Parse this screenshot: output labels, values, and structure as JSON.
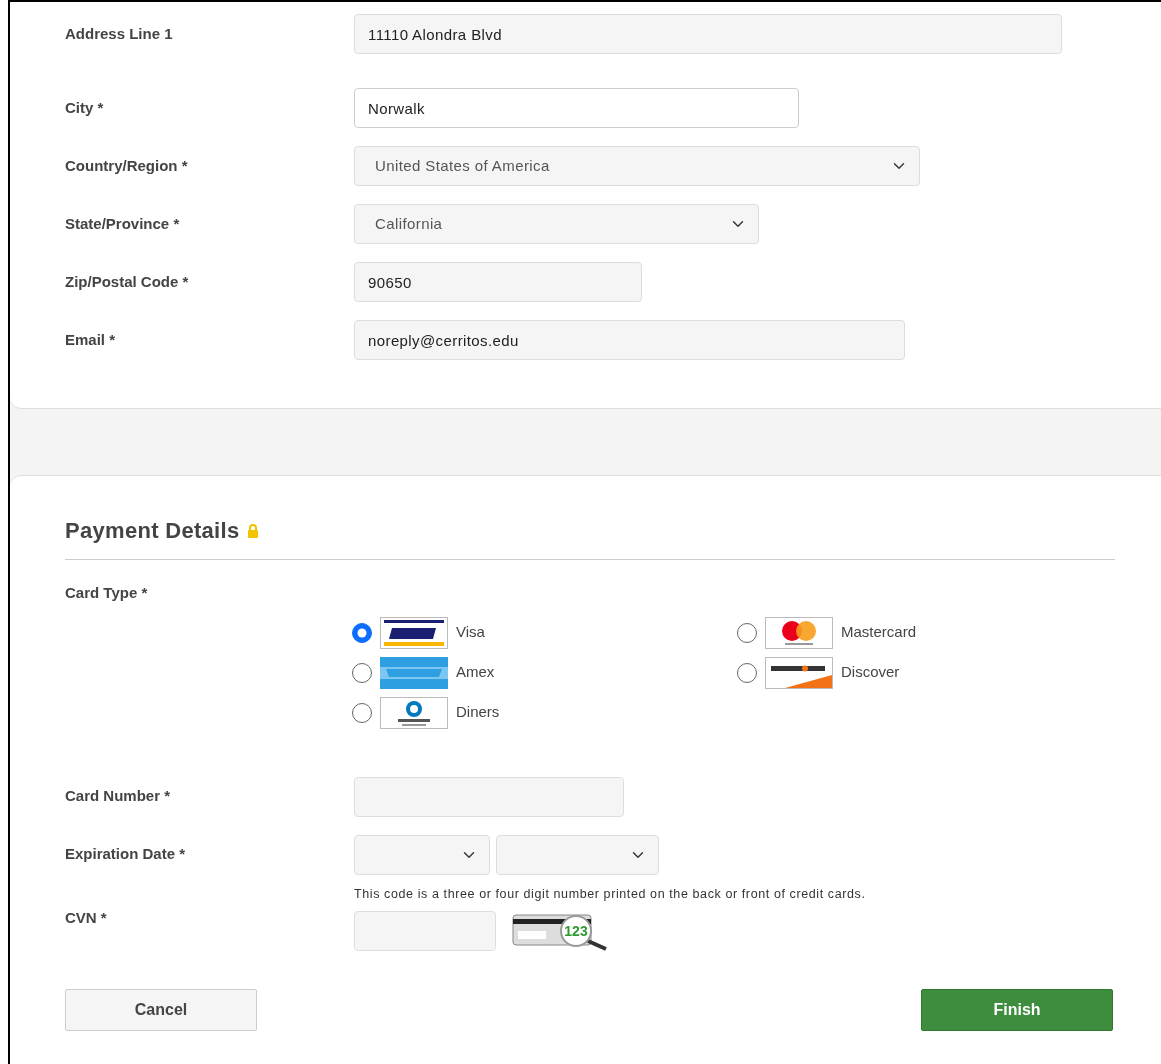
{
  "address_fields": [
    {
      "label": "Address Line 1",
      "kind": "text",
      "value": "11110 Alondra Blvd",
      "focused": false
    },
    {
      "label": "City *",
      "kind": "text",
      "value": "Norwalk",
      "focused": true
    },
    {
      "label": "Country/Region *",
      "kind": "select",
      "value": "United States of America",
      "focused": false
    },
    {
      "label": "State/Province *",
      "kind": "select",
      "value": "California",
      "focused": false
    },
    {
      "label": "Zip/Postal Code *",
      "kind": "text",
      "value": "90650",
      "focused": false
    },
    {
      "label": "Email *",
      "kind": "text",
      "value": "noreply@cerritos.edu",
      "focused": false
    }
  ],
  "payment": {
    "title": "Payment Details",
    "card_type_label": "Card Type *",
    "card_types": [
      {
        "kind": "visa",
        "label": "Visa",
        "selected": true
      },
      {
        "kind": "mastercard",
        "label": "Mastercard",
        "selected": false
      },
      {
        "kind": "amex",
        "label": "Amex",
        "selected": false
      },
      {
        "kind": "discover",
        "label": "Discover",
        "selected": false
      },
      {
        "kind": "diners",
        "label": "Diners",
        "selected": false
      }
    ],
    "card_number_label": "Card Number *",
    "expiration_label": "Expiration Date *",
    "cvn_label": "CVN *",
    "cvn_hint": "This code is a three or four digit number printed on the back or front of credit cards.",
    "cvn_icon_text": "123"
  },
  "buttons": [
    {
      "kind": "cancel",
      "label": "Cancel"
    },
    {
      "kind": "finish",
      "label": "Finish"
    }
  ]
}
